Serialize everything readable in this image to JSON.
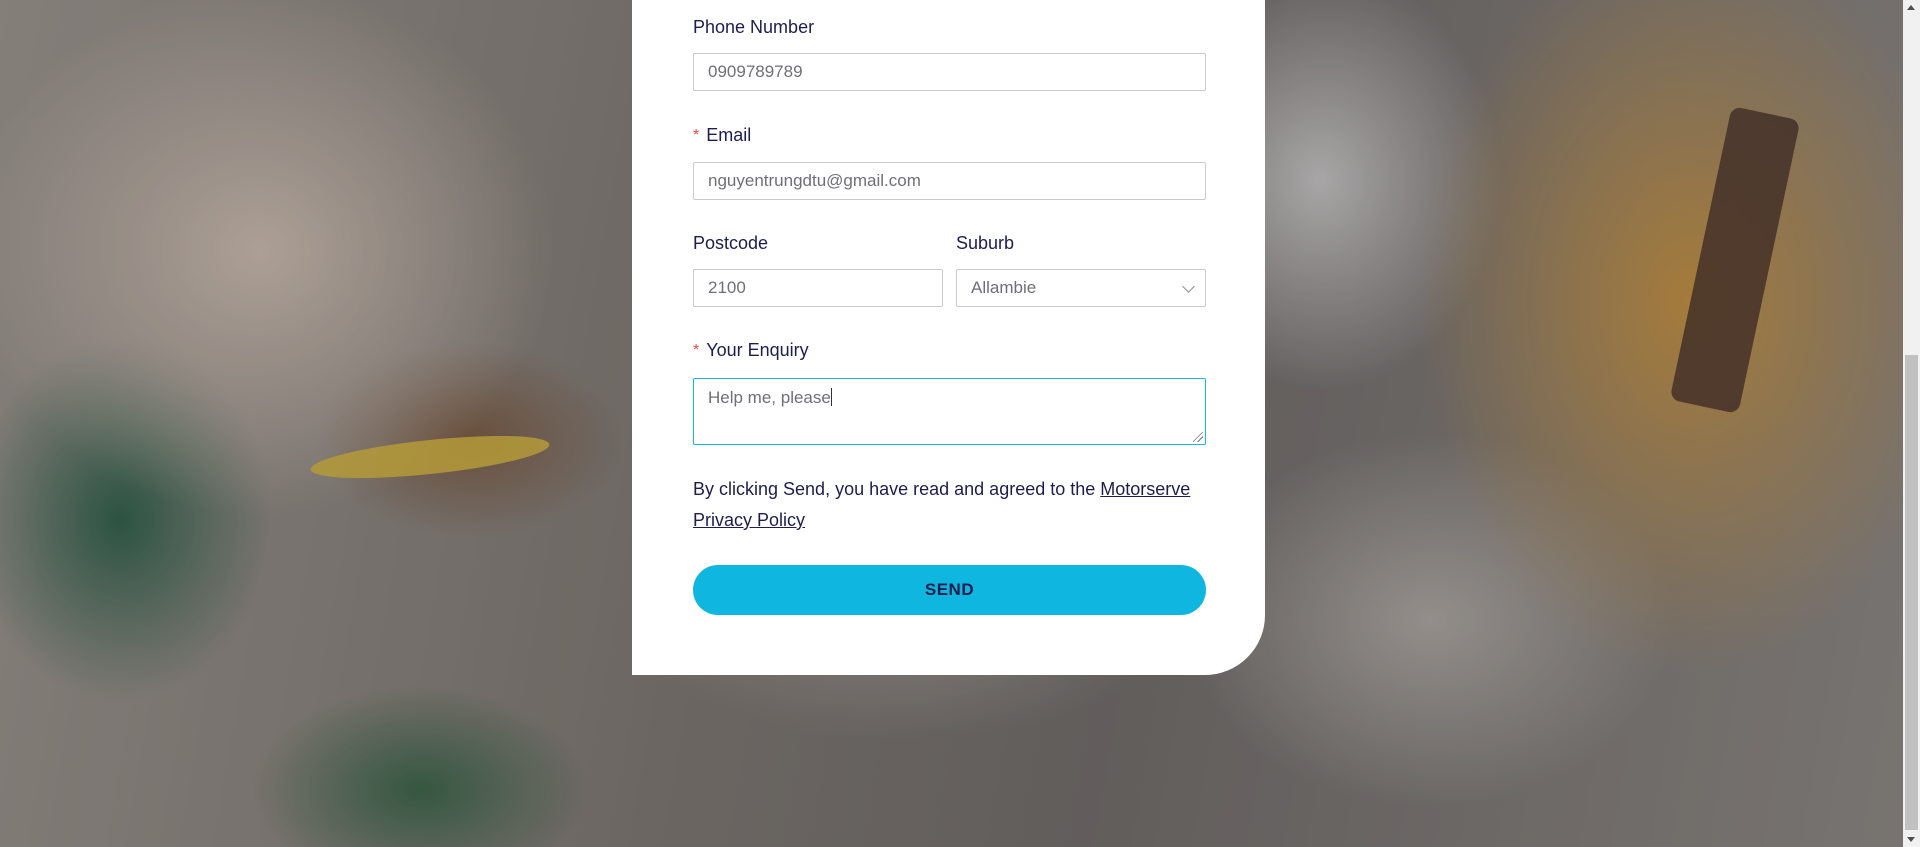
{
  "form": {
    "phone": {
      "label": "Phone Number",
      "value": "0909789789"
    },
    "email": {
      "label": "Email",
      "value": "nguyentrungdtu@gmail.com",
      "required_mark": "*"
    },
    "postcode": {
      "label": "Postcode",
      "value": "2100"
    },
    "suburb": {
      "label": "Suburb",
      "selected": "Allambie"
    },
    "enquiry": {
      "label": "Your Enquiry",
      "value": "Help me, please",
      "required_mark": "*"
    },
    "consent": {
      "text": "By clicking Send, you have read and agreed to the ",
      "link": "Motorserve Privacy Policy"
    },
    "send_label": "SEND"
  },
  "colors": {
    "accent": "#0fb7e0",
    "label_text": "#1d1d4f",
    "required": "#e84a45",
    "focus_border": "#19b7e3"
  }
}
